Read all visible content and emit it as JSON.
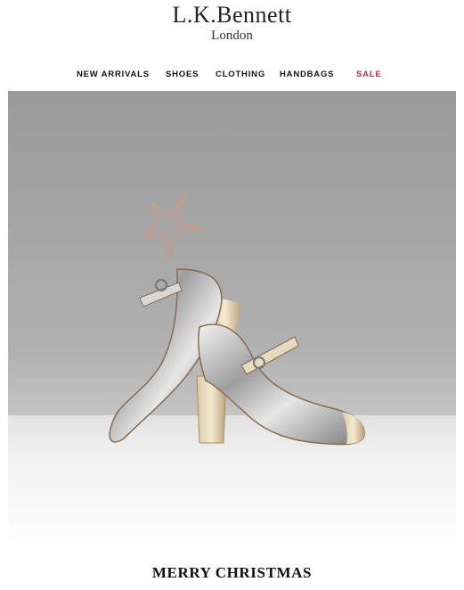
{
  "brand": {
    "name": "L.K.Bennett",
    "city": "London"
  },
  "nav": {
    "items": [
      {
        "label": "NEW ARRIVALS"
      },
      {
        "label": "SHOES"
      },
      {
        "label": "CLOTHING"
      },
      {
        "label": "HANDBAGS"
      },
      {
        "label": "SALE"
      }
    ],
    "sale_color": "#c3285c"
  },
  "hero": {
    "alt": "Metallic silver Mary Jane heels with star decoration"
  },
  "footer": {
    "title": "MERRY CHRISTMAS"
  }
}
